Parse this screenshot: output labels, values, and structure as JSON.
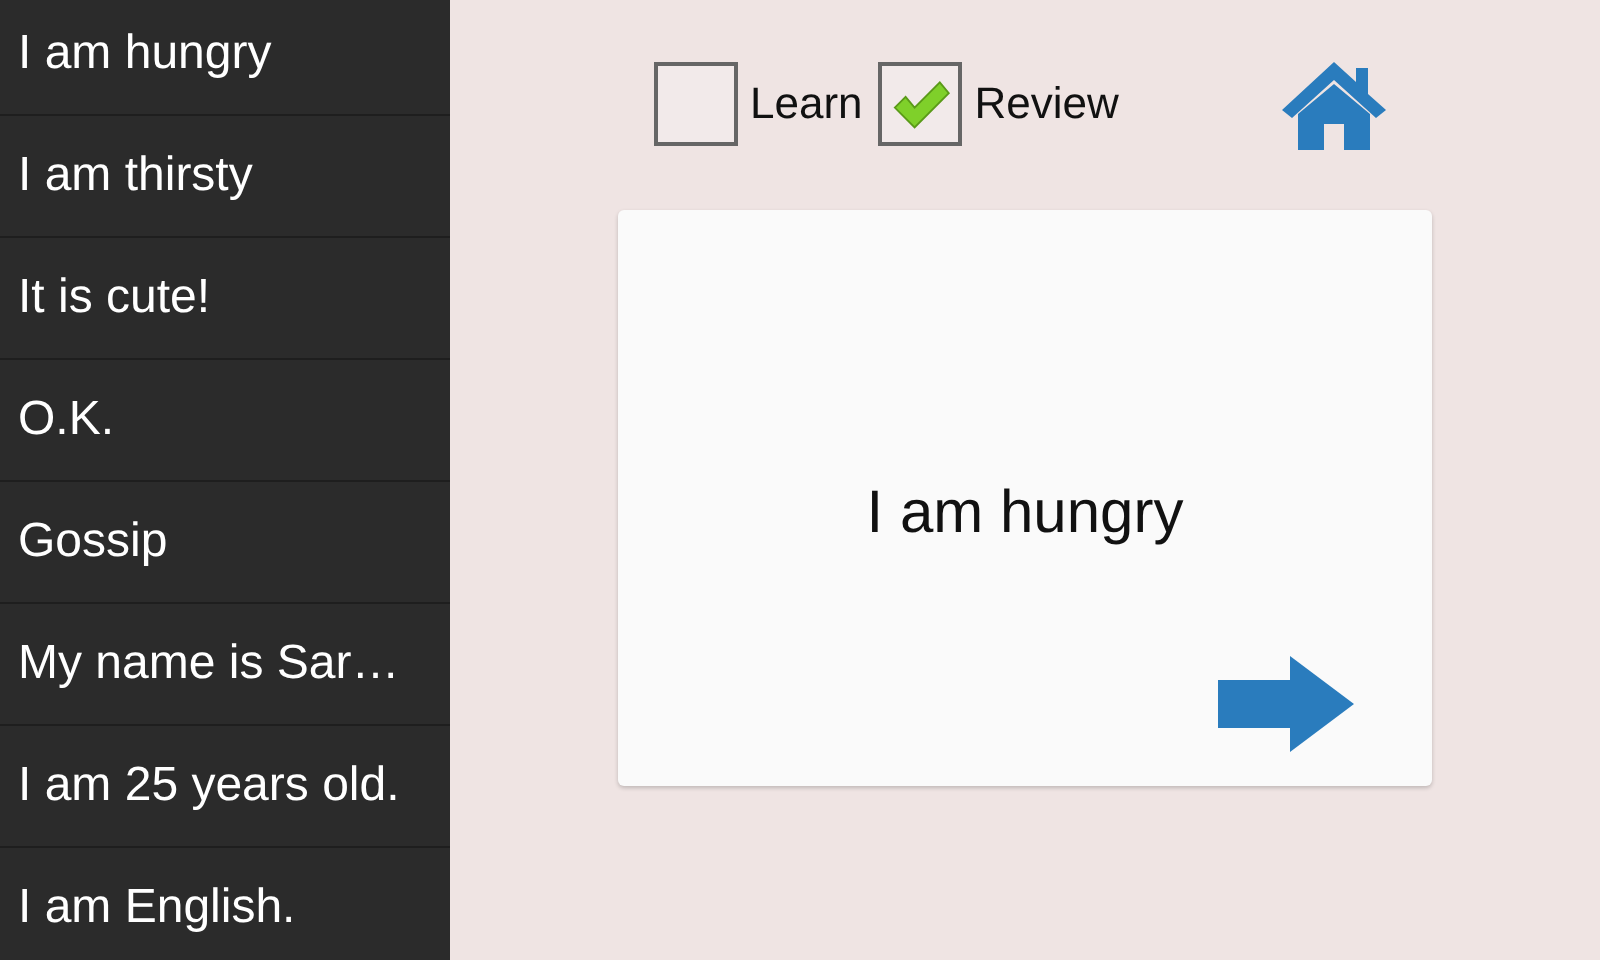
{
  "phrases": [
    {
      "text": "I am hungry"
    },
    {
      "text": "I am thirsty"
    },
    {
      "text": "It is cute!"
    },
    {
      "text": "O.K."
    },
    {
      "text": "Gossip"
    },
    {
      "text": "My name is Sar…"
    },
    {
      "text": "I am 25 years old."
    },
    {
      "text": "I am English."
    }
  ],
  "modes": [
    {
      "label": "Learn",
      "checked": false
    },
    {
      "label": "Review",
      "checked": true
    }
  ],
  "card": {
    "text": "I am hungry"
  }
}
